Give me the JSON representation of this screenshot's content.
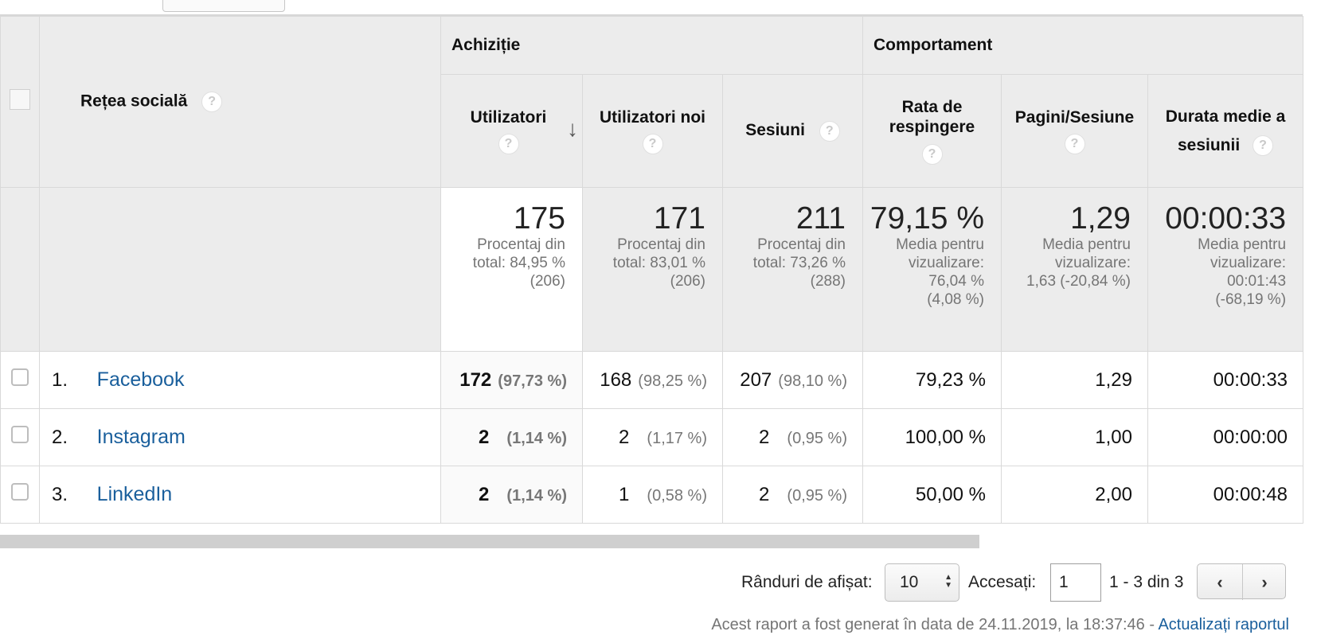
{
  "table": {
    "dimension_header": "Rețea socială",
    "groups": {
      "acquisition": "Achiziție",
      "behavior": "Comportament"
    },
    "columns": {
      "users": "Utilizatori",
      "new_users": "Utilizatori noi",
      "sessions": "Sesiuni",
      "bounce_rate_line1": "Rata de",
      "bounce_rate_line2": "respingere",
      "pages_per_session": "Pagini/Sesiune",
      "avg_duration_line1": "Durata medie a",
      "avg_duration_line2": "sesiunii"
    },
    "help_glyph": "?",
    "sort_arrow": "↓",
    "totals": {
      "users": {
        "value": "175",
        "l1": "Procentaj din",
        "l2": "total: 84,95 %",
        "l3": "(206)"
      },
      "new_users": {
        "value": "171",
        "l1": "Procentaj din",
        "l2": "total: 83,01 %",
        "l3": "(206)"
      },
      "sessions": {
        "value": "211",
        "l1": "Procentaj din",
        "l2": "total: 73,26 %",
        "l3": "(288)"
      },
      "bounce_rate": {
        "value": "79,15 %",
        "l1": "Media pentru",
        "l2": "vizualizare:",
        "l3": "76,04 %",
        "l4": "(4,08 %)"
      },
      "pages_per_session": {
        "value": "1,29",
        "l1": "Media pentru",
        "l2": "vizualizare:",
        "l3": "1,63 (-20,84 %)"
      },
      "avg_duration": {
        "value": "00:00:33",
        "l1": "Media pentru",
        "l2": "vizualizare:",
        "l3": "00:01:43",
        "l4": "(-68,19 %)"
      }
    },
    "rows": [
      {
        "index": "1.",
        "name": "Facebook",
        "users": "172",
        "users_pct": "(97,73 %)",
        "new_users": "168",
        "new_users_pct": "(98,25 %)",
        "sessions": "207",
        "sessions_pct": "(98,10 %)",
        "bounce_rate": "79,23 %",
        "pages_per_session": "1,29",
        "avg_duration": "00:00:33"
      },
      {
        "index": "2.",
        "name": "Instagram",
        "users": "2",
        "users_pct": "(1,14 %)",
        "new_users": "2",
        "new_users_pct": "(1,17 %)",
        "sessions": "2",
        "sessions_pct": "(0,95 %)",
        "bounce_rate": "100,00 %",
        "pages_per_session": "1,00",
        "avg_duration": "00:00:00"
      },
      {
        "index": "3.",
        "name": "LinkedIn",
        "users": "2",
        "users_pct": "(1,14 %)",
        "new_users": "1",
        "new_users_pct": "(0,58 %)",
        "sessions": "2",
        "sessions_pct": "(0,95 %)",
        "bounce_rate": "50,00 %",
        "pages_per_session": "2,00",
        "avg_duration": "00:00:48"
      }
    ]
  },
  "pagination": {
    "rows_label": "Rânduri de afișat:",
    "rows_value": "10",
    "goto_label": "Accesați:",
    "goto_value": "1",
    "range": "1 - 3 din 3",
    "prev_glyph": "‹",
    "next_glyph": "›"
  },
  "footer": {
    "text": "Acest raport a fost generat în data de 24.11.2019, la 18:37:46 - ",
    "link": "Actualizați raportul"
  },
  "colors": {
    "link": "#1a5f9c",
    "header_bg": "#ececec",
    "border": "#d9d9d9"
  }
}
